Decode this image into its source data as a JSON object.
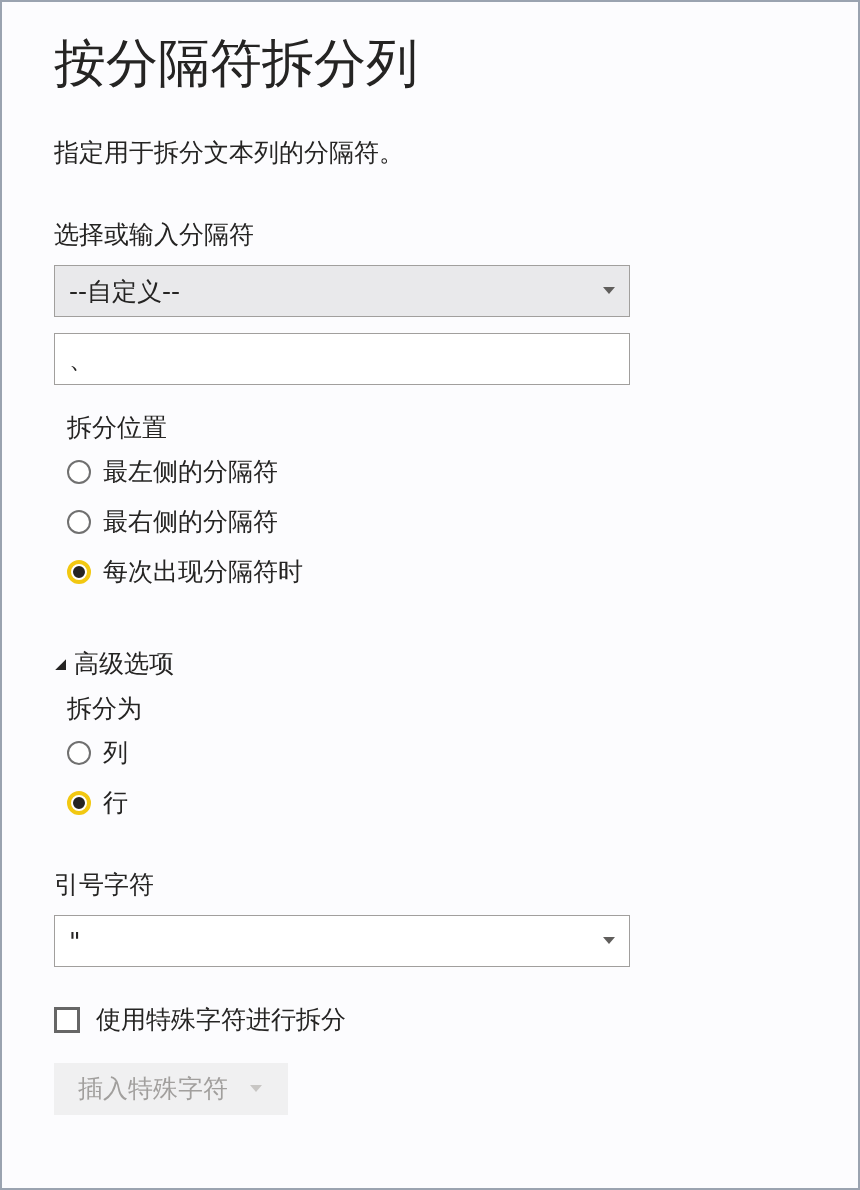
{
  "title": "按分隔符拆分列",
  "description": "指定用于拆分文本列的分隔符。",
  "delimiter": {
    "label": "选择或输入分隔符",
    "dropdown": {
      "value": "--自定义--"
    },
    "custom": {
      "value": "、"
    }
  },
  "split_at": {
    "label": "拆分位置",
    "options": [
      {
        "label": "最左侧的分隔符",
        "selected": false
      },
      {
        "label": "最右侧的分隔符",
        "selected": false
      },
      {
        "label": "每次出现分隔符时",
        "selected": true
      }
    ]
  },
  "advanced": {
    "label": "高级选项",
    "expanded": true,
    "split_into": {
      "label": "拆分为",
      "options": [
        {
          "label": "列",
          "selected": false
        },
        {
          "label": "行",
          "selected": true
        }
      ]
    },
    "quote": {
      "label": "引号字符",
      "value": "\""
    },
    "special": {
      "label": "使用特殊字符进行拆分",
      "checked": false
    },
    "insert_button": {
      "label": "插入特殊字符",
      "disabled": true
    }
  }
}
